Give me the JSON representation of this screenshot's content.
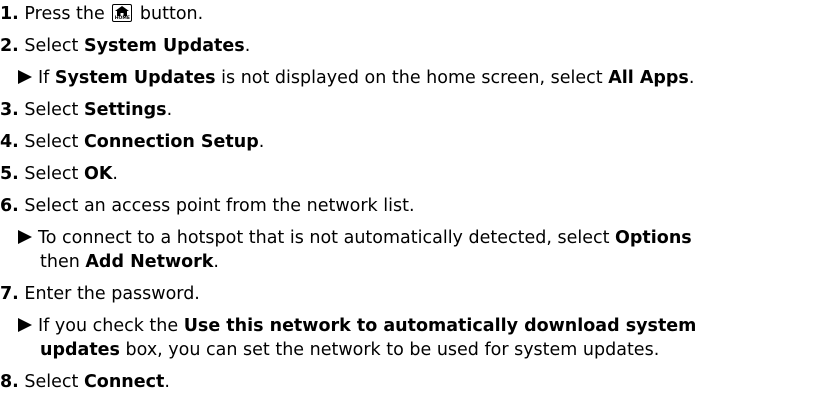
{
  "steps": [
    {
      "num": "1.",
      "before": "Press the",
      "after": "button.",
      "icon": "home-icon",
      "icon_label": "HOME"
    },
    {
      "num": "2.",
      "pre": "Select ",
      "bold": "System Updates",
      "post": "."
    },
    {
      "note": {
        "a": "If ",
        "b1": "System Updates",
        "c": " is not displayed on the home screen, select ",
        "b2": "All Apps",
        "d": "."
      }
    },
    {
      "num": "3.",
      "pre": "Select ",
      "bold": "Settings",
      "post": "."
    },
    {
      "num": "4.",
      "pre": "Select ",
      "bold": "Connection Setup",
      "post": "."
    },
    {
      "num": "5.",
      "pre": "Select ",
      "bold": "OK",
      "post": "."
    },
    {
      "num": "6.",
      "text": "Select an access point from the network list."
    },
    {
      "note": {
        "a": "To connect to a hotspot that is not automatically detected, select ",
        "b1": "Options",
        "cont_a": "then ",
        "b2": "Add Network",
        "cont_b": "."
      }
    },
    {
      "num": "7.",
      "text": "Enter the password."
    },
    {
      "note": {
        "a": "If you check the ",
        "b1": "Use this network to automatically download system",
        "b2": "updates",
        "cont_b": " box, you can set the network to be used for system updates."
      }
    },
    {
      "num": "8.",
      "pre": "Select ",
      "bold": "Connect",
      "post": "."
    }
  ]
}
